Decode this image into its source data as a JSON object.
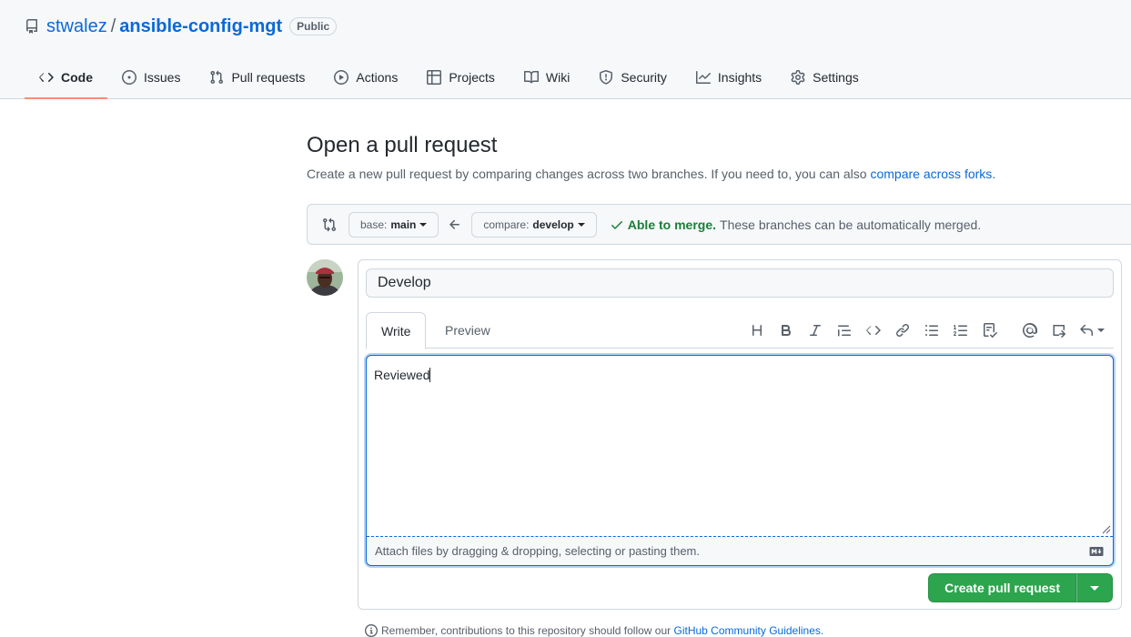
{
  "repo": {
    "owner": "stwalez",
    "separator": "/",
    "name": "ansible-config-mgt",
    "visibility": "Public",
    "icon": "repo-book-icon"
  },
  "nav": {
    "tabs": [
      {
        "label": "Code",
        "icon": "code-icon",
        "selected": true
      },
      {
        "label": "Issues",
        "icon": "issue-circle-icon"
      },
      {
        "label": "Pull requests",
        "icon": "pull-request-icon"
      },
      {
        "label": "Actions",
        "icon": "play-icon"
      },
      {
        "label": "Projects",
        "icon": "table-icon"
      },
      {
        "label": "Wiki",
        "icon": "book-icon"
      },
      {
        "label": "Security",
        "icon": "shield-icon"
      },
      {
        "label": "Insights",
        "icon": "graph-icon"
      },
      {
        "label": "Settings",
        "icon": "gear-icon"
      }
    ],
    "accent": "#fd8c73"
  },
  "page": {
    "title": "Open a pull request",
    "subtitle": "Create a new pull request by comparing changes across two branches. If you need to, you can also",
    "subtitle_link": "compare across forks."
  },
  "range": {
    "base_label": "base:",
    "base_value": "main",
    "compare_label": "compare:",
    "compare_value": "develop",
    "merge_status": "Able to merge.",
    "merge_detail": "These branches can be automatically merged.",
    "status_color": "#1a7f37"
  },
  "form": {
    "title_value": "Develop",
    "tabs": {
      "write": "Write",
      "preview": "Preview"
    },
    "toolbar": [
      "heading-icon",
      "bold-icon",
      "italic-icon",
      "quote-icon",
      "code-icon",
      "link-icon",
      "unordered-list-icon",
      "ordered-list-icon",
      "task-list-icon",
      "mention-icon",
      "reference-icon",
      "reply-icon"
    ],
    "body_value": "Reviewed",
    "attach_text": "Attach files by dragging & dropping, selecting or pasting them.",
    "submit_label": "Create pull request",
    "button_color": "#2da44e"
  },
  "footnote": {
    "text": "Remember, contributions to this repository should follow our",
    "link": "GitHub Community Guidelines."
  }
}
